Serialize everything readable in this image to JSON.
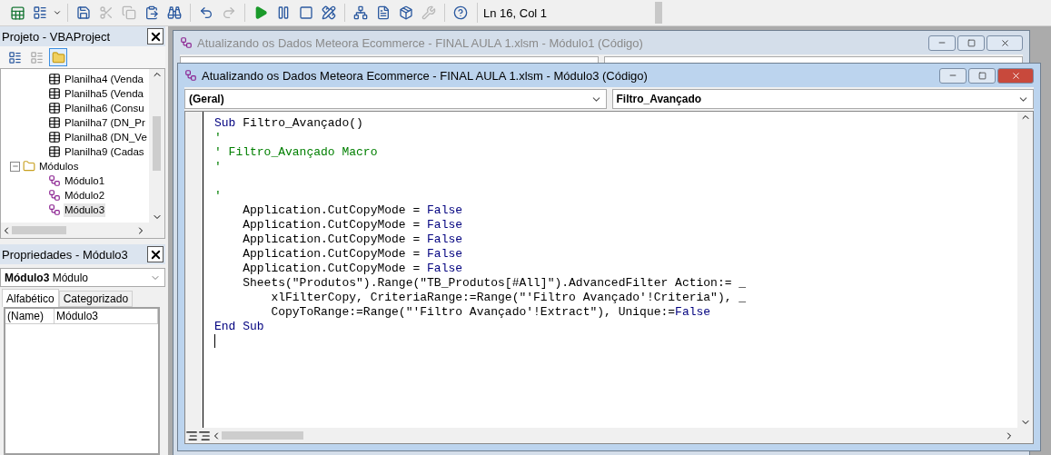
{
  "toolbar": {
    "buttons": [
      {
        "kind": "excel",
        "disabled": false
      },
      {
        "kind": "insert",
        "disabled": false
      },
      {
        "kind": "save",
        "disabled": false
      },
      {
        "kind": "cut",
        "disabled": true
      },
      {
        "kind": "copy",
        "disabled": true
      },
      {
        "kind": "paste",
        "disabled": false
      },
      {
        "kind": "find",
        "disabled": false
      },
      {
        "kind": "undo",
        "disabled": false
      },
      {
        "kind": "redo",
        "disabled": true
      },
      {
        "kind": "run",
        "disabled": false
      },
      {
        "kind": "pause",
        "disabled": false
      },
      {
        "kind": "stop",
        "disabled": false
      },
      {
        "kind": "design",
        "disabled": false
      },
      {
        "kind": "explorer",
        "disabled": false
      },
      {
        "kind": "properties",
        "disabled": false
      },
      {
        "kind": "browser",
        "disabled": false
      },
      {
        "kind": "tools",
        "disabled": true
      },
      {
        "kind": "help",
        "disabled": false
      }
    ],
    "position": "Ln 16, Col 1"
  },
  "project": {
    "title": "Projeto - VBAProject",
    "tree": [
      {
        "kind": "group",
        "children": [
          {
            "kind": "sheet",
            "label": "Planilha4 (Venda",
            "selected": false
          },
          {
            "kind": "sheet",
            "label": "Planilha5 (Venda",
            "selected": false
          },
          {
            "kind": "sheet",
            "label": "Planilha6 (Consu",
            "selected": false
          },
          {
            "kind": "sheet",
            "label": "Planilha7 (DN_Pr",
            "selected": false
          },
          {
            "kind": "sheet",
            "label": "Planilha8 (DN_Ve",
            "selected": false
          },
          {
            "kind": "sheet",
            "label": "Planilha9 (Cadas",
            "selected": false
          }
        ]
      },
      {
        "kind": "folder",
        "label": "Módulos",
        "selected": false,
        "expanded": true,
        "children": [
          {
            "kind": "module",
            "label": "Módulo1",
            "selected": false
          },
          {
            "kind": "module",
            "label": "Módulo2",
            "selected": false
          },
          {
            "kind": "module",
            "label": "Módulo3",
            "selected": true
          }
        ]
      }
    ]
  },
  "properties": {
    "title": "Propriedades - Módulo3",
    "object_name": "Módulo3",
    "object_type": "Módulo",
    "tabs": [
      {
        "label": "Alfabético",
        "selected": true
      },
      {
        "label": "Categorizado",
        "selected": false
      }
    ],
    "rows": [
      {
        "name": "(Name)",
        "value": "Módulo3"
      }
    ]
  },
  "back_window": {
    "title": "Atualizando os Dados Meteora Ecommerce - FINAL AULA 1.xlsm - Módulo1 (Código)"
  },
  "code_window": {
    "title": "Atualizando os Dados Meteora Ecommerce - FINAL AULA 1.xlsm - Módulo3 (Código)",
    "object": "(Geral)",
    "procedure": "Filtro_Avançado",
    "lines": [
      {
        "kind": "code",
        "tokens": [
          {
            "kind": "keyword",
            "text": "Sub"
          },
          {
            "kind": "plain",
            "text": " Filtro_Avançado()"
          }
        ]
      },
      {
        "kind": "code",
        "tokens": [
          {
            "kind": "comment",
            "text": "'"
          }
        ]
      },
      {
        "kind": "code",
        "tokens": [
          {
            "kind": "comment",
            "text": "' Filtro_Avançado Macro"
          }
        ]
      },
      {
        "kind": "code",
        "tokens": [
          {
            "kind": "comment",
            "text": "'"
          }
        ]
      },
      {
        "kind": "blank"
      },
      {
        "kind": "code",
        "tokens": [
          {
            "kind": "comment",
            "text": "'"
          }
        ]
      },
      {
        "kind": "code",
        "tokens": [
          {
            "kind": "plain",
            "text": "    Application.CutCopyMode = "
          },
          {
            "kind": "keyword",
            "text": "False"
          }
        ]
      },
      {
        "kind": "code",
        "tokens": [
          {
            "kind": "plain",
            "text": "    Application.CutCopyMode = "
          },
          {
            "kind": "keyword",
            "text": "False"
          }
        ]
      },
      {
        "kind": "code",
        "tokens": [
          {
            "kind": "plain",
            "text": "    Application.CutCopyMode = "
          },
          {
            "kind": "keyword",
            "text": "False"
          }
        ]
      },
      {
        "kind": "code",
        "tokens": [
          {
            "kind": "plain",
            "text": "    Application.CutCopyMode = "
          },
          {
            "kind": "keyword",
            "text": "False"
          }
        ]
      },
      {
        "kind": "code",
        "tokens": [
          {
            "kind": "plain",
            "text": "    Application.CutCopyMode = "
          },
          {
            "kind": "keyword",
            "text": "False"
          }
        ]
      },
      {
        "kind": "code",
        "tokens": [
          {
            "kind": "plain",
            "text": "    Sheets(\"Produtos\").Range(\"TB_Produtos[#All]\").AdvancedFilter Action:= _"
          }
        ]
      },
      {
        "kind": "code",
        "tokens": [
          {
            "kind": "plain",
            "text": "        xlFilterCopy, CriteriaRange:=Range(\"'Filtro Avançado'!Criteria\"), _"
          }
        ]
      },
      {
        "kind": "code",
        "tokens": [
          {
            "kind": "plain",
            "text": "        CopyToRange:=Range(\"'Filtro Avançado'!Extract\"), Unique:="
          },
          {
            "kind": "keyword",
            "text": "False"
          }
        ]
      },
      {
        "kind": "code",
        "tokens": [
          {
            "kind": "keyword",
            "text": "End Sub"
          }
        ]
      },
      {
        "kind": "caret"
      }
    ]
  }
}
